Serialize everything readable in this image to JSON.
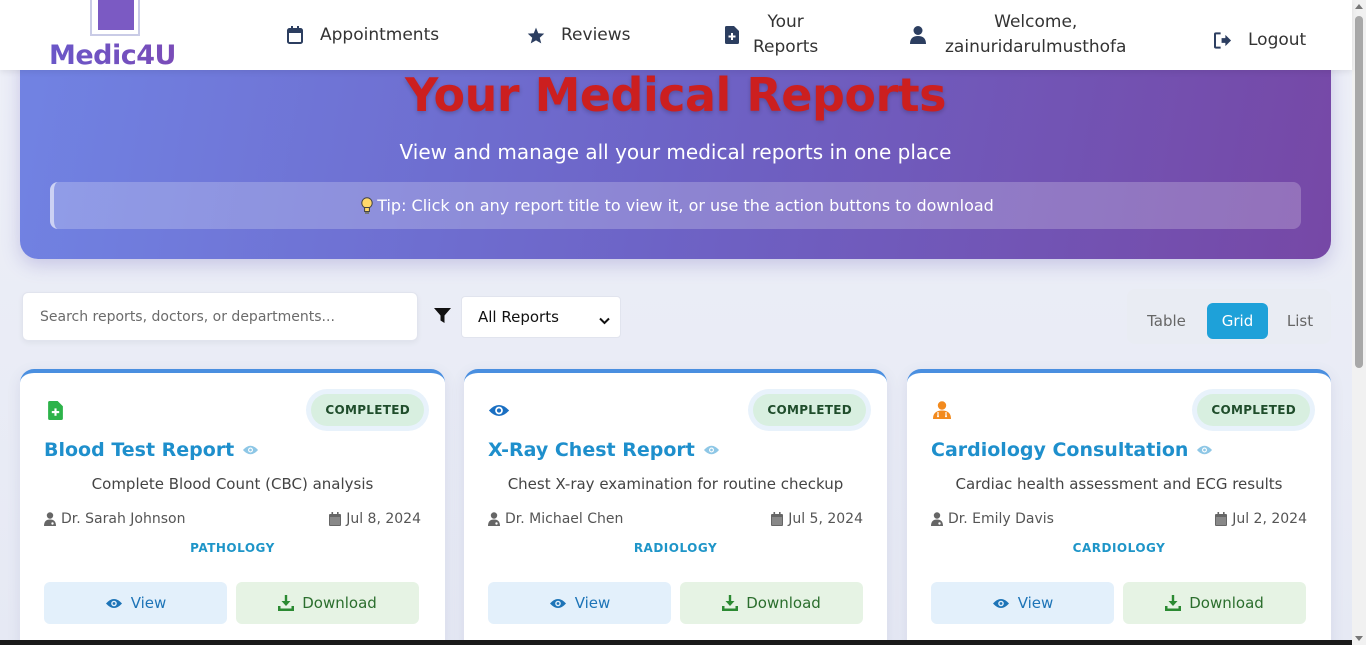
{
  "brand": {
    "name": "Medic4U"
  },
  "nav": {
    "appointments": "Appointments",
    "reviews": "Reviews",
    "reports_line1": "Your",
    "reports_line2": "Reports",
    "welcome_line1": "Welcome,",
    "welcome_line2": "zainuridarulmusthofa",
    "logout": "Logout"
  },
  "hero": {
    "title": "Your Medical Reports",
    "subtitle": "View and manage all your medical reports in one place",
    "tip": "Tip: Click on any report title to view it, or use the action buttons to download"
  },
  "controls": {
    "search_placeholder": "Search reports, doctors, or departments...",
    "filter_value": "All Reports",
    "views": [
      "Table",
      "Grid",
      "List"
    ],
    "active_view": "Grid"
  },
  "reports": [
    {
      "icon": "file-medical-icon",
      "status": "COMPLETED",
      "title": "Blood Test Report",
      "description": "Complete Blood Count (CBC) analysis",
      "doctor": "Dr. Sarah Johnson",
      "date": "Jul 8, 2024",
      "department": "PATHOLOGY",
      "view_label": "View",
      "download_label": "Download"
    },
    {
      "icon": "eye-icon",
      "status": "COMPLETED",
      "title": "X-Ray Chest Report",
      "description": "Chest X-ray examination for routine checkup",
      "doctor": "Dr. Michael Chen",
      "date": "Jul 5, 2024",
      "department": "RADIOLOGY",
      "view_label": "View",
      "download_label": "Download"
    },
    {
      "icon": "user-doctor-icon",
      "status": "COMPLETED",
      "title": "Cardiology Consultation",
      "description": "Cardiac health assessment and ECG results",
      "doctor": "Dr. Emily Davis",
      "date": "Jul 2, 2024",
      "department": "CARDIOLOGY",
      "view_label": "View",
      "download_label": "Download"
    }
  ],
  "colors": {
    "accent": "#1ea1d9",
    "title_red": "#cc1f1f",
    "status_bg": "#d8efe0"
  }
}
